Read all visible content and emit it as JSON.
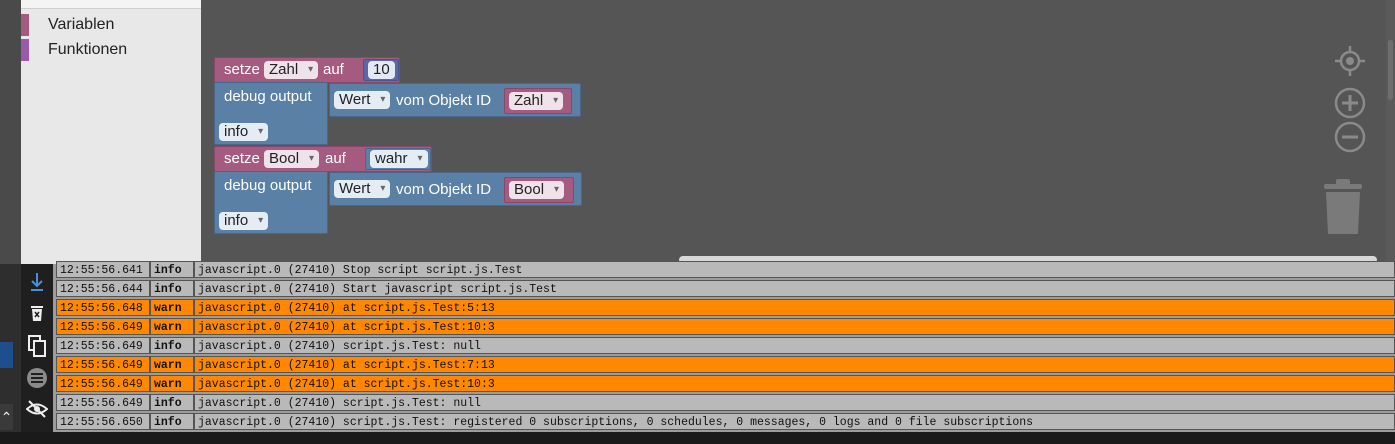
{
  "toolbox": {
    "items": [
      {
        "label": "Variablen",
        "color": "#a55b80"
      },
      {
        "label": "Funktionen",
        "color": "#995ba5"
      }
    ]
  },
  "workspace": {
    "block1": {
      "setze_label": "setze",
      "var_name": "Zahl",
      "auf_label": "auf",
      "value": "10",
      "debug_label": "debug output",
      "prop_field": "Wert",
      "vom_label": "vom Objekt ID",
      "obj_var": "Zahl",
      "level": "info"
    },
    "block2": {
      "setze_label": "setze",
      "var_name": "Bool",
      "auf_label": "auf",
      "value": "wahr",
      "debug_label": "debug output",
      "prop_field": "Wert",
      "vom_label": "vom Objekt ID",
      "obj_var": "Bool",
      "level": "info"
    },
    "tools": {
      "center_icon": "crosshair-icon",
      "zoom_in_icon": "zoom-in-icon",
      "zoom_out_icon": "zoom-out-icon",
      "trash_icon": "trash-icon"
    }
  },
  "log": {
    "sidebar_icons": [
      "scroll-down-icon",
      "delete-log-icon",
      "copy-icon",
      "list-icon",
      "hide-icon"
    ],
    "rows": [
      {
        "time": "12:55:56.641",
        "level": "info",
        "message": "javascript.0 (27410) Stop script script.js.Test"
      },
      {
        "time": "12:55:56.644",
        "level": "info",
        "message": "javascript.0 (27410) Start javascript script.js.Test"
      },
      {
        "time": "12:55:56.648",
        "level": "warn",
        "message": "javascript.0 (27410) at script.js.Test:5:13"
      },
      {
        "time": "12:55:56.649",
        "level": "warn",
        "message": "javascript.0 (27410) at script.js.Test:10:3"
      },
      {
        "time": "12:55:56.649",
        "level": "info",
        "message": "javascript.0 (27410) script.js.Test: null"
      },
      {
        "time": "12:55:56.649",
        "level": "warn",
        "message": "javascript.0 (27410) at script.js.Test:7:13"
      },
      {
        "time": "12:55:56.649",
        "level": "warn",
        "message": "javascript.0 (27410) at script.js.Test:10:3"
      },
      {
        "time": "12:55:56.649",
        "level": "info",
        "message": "javascript.0 (27410) script.js.Test: null"
      },
      {
        "time": "12:55:56.650",
        "level": "info",
        "message": "javascript.0 (27410) script.js.Test: registered 0 subscriptions, 0 schedules, 0 messages, 0 logs and 0 file subscriptions"
      }
    ]
  }
}
